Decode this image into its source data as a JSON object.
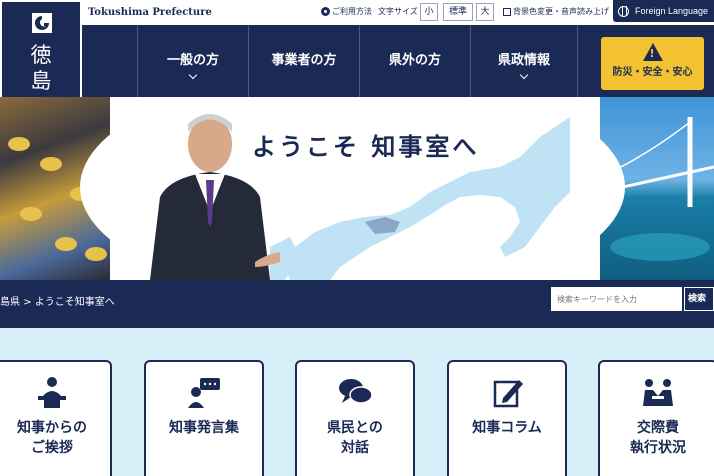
{
  "header": {
    "brand_en": "Tokushima Prefecture",
    "logo_text": "徳\n島\n県",
    "help_link": "ご利用方法",
    "font_size_label": "文字サイズ",
    "font_size_options": [
      "小",
      "標準",
      "大"
    ],
    "color_reader_link": "背景色変更・音声読み上げ",
    "foreign_language": "Foreign Language"
  },
  "nav": {
    "items": [
      {
        "label": "一般の方",
        "has_dropdown": true
      },
      {
        "label": "事業者の方",
        "has_dropdown": false
      },
      {
        "label": "県外の方",
        "has_dropdown": false
      },
      {
        "label": "県政情報",
        "has_dropdown": true
      }
    ],
    "disaster_label": "防災・安全・安心"
  },
  "hero": {
    "title": "ようこそ 知事室へ"
  },
  "breadcrumb": {
    "text": "島県 > ようこそ知事室へ"
  },
  "search": {
    "placeholder": "検索キーワードを入力",
    "button_label": "検索"
  },
  "cards": [
    {
      "label": "知事からの\nご挨拶",
      "icon": "podium-speaker-icon"
    },
    {
      "label": "知事発言集",
      "icon": "speech-bubble-person-icon"
    },
    {
      "label": "県民との\n対話",
      "icon": "chat-bubbles-icon"
    },
    {
      "label": "知事コラム",
      "icon": "pen-writing-icon"
    },
    {
      "label": "交際費\n執行状況",
      "icon": "meeting-people-icon"
    }
  ],
  "colors": {
    "navy": "#1b2a55",
    "accent_yellow": "#f3c231",
    "card_area_bg": "#d8eef8"
  }
}
